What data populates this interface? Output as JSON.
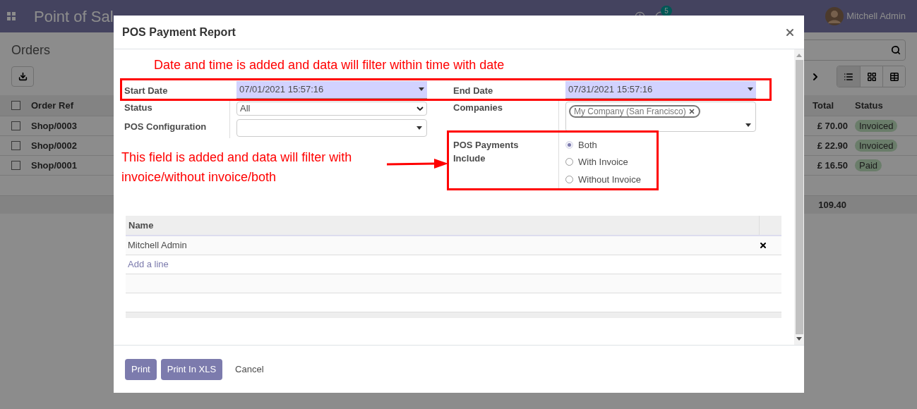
{
  "navbar": {
    "app_title": "Point of Sal",
    "message_count": "5",
    "user": "Mitchell Admin"
  },
  "page": {
    "title": "Orders",
    "views": [
      {
        "kind": "list",
        "selected": true
      },
      {
        "kind": "kanban",
        "selected": false
      },
      {
        "kind": "pivot",
        "selected": false
      }
    ],
    "table": {
      "select_all_checked": false,
      "columns": [
        "Order Ref",
        "Total",
        "Status"
      ],
      "rows": [
        {
          "checked": false,
          "ref": "Shop/0003",
          "total": "£ 70.00",
          "status": "Invoiced"
        },
        {
          "checked": false,
          "ref": "Shop/0002",
          "total": "£ 22.90",
          "status": "Invoiced"
        },
        {
          "checked": false,
          "ref": "Shop/0001",
          "total": "£ 16.50",
          "status": "Paid"
        }
      ],
      "footer_total": "109.40"
    }
  },
  "dialog": {
    "title": "POS Payment Report",
    "top_note": "Date and time is added and data will filter within time with date",
    "side_note": "This field is added and data will filter with invoice/without invoice/both",
    "start_date": {
      "label": "Start Date",
      "value": "07/01/2021 15:57:16"
    },
    "status": {
      "label": "Status",
      "value": "All"
    },
    "pos_configuration": {
      "label": "POS Configuration"
    },
    "end_date": {
      "label": "End Date",
      "value": "07/31/2021 15:57:16"
    },
    "companies": {
      "label": "Companies",
      "tags": [
        "My Company (San Francisco)"
      ]
    },
    "payments_include": {
      "label": "POS Payments Include",
      "options": [
        {
          "label": "Both",
          "selected": true
        },
        {
          "label": "With Invoice",
          "selected": false
        },
        {
          "label": "Without Invoice",
          "selected": false
        }
      ]
    },
    "lines": {
      "column": "Name",
      "rows": [
        {
          "name": "Mitchell Admin"
        }
      ],
      "add_line": "Add a line"
    },
    "buttons": [
      {
        "label": "Print",
        "kind": "primary"
      },
      {
        "label": "Print In XLS",
        "kind": "primary"
      },
      {
        "label": "Cancel",
        "kind": "link"
      }
    ]
  }
}
